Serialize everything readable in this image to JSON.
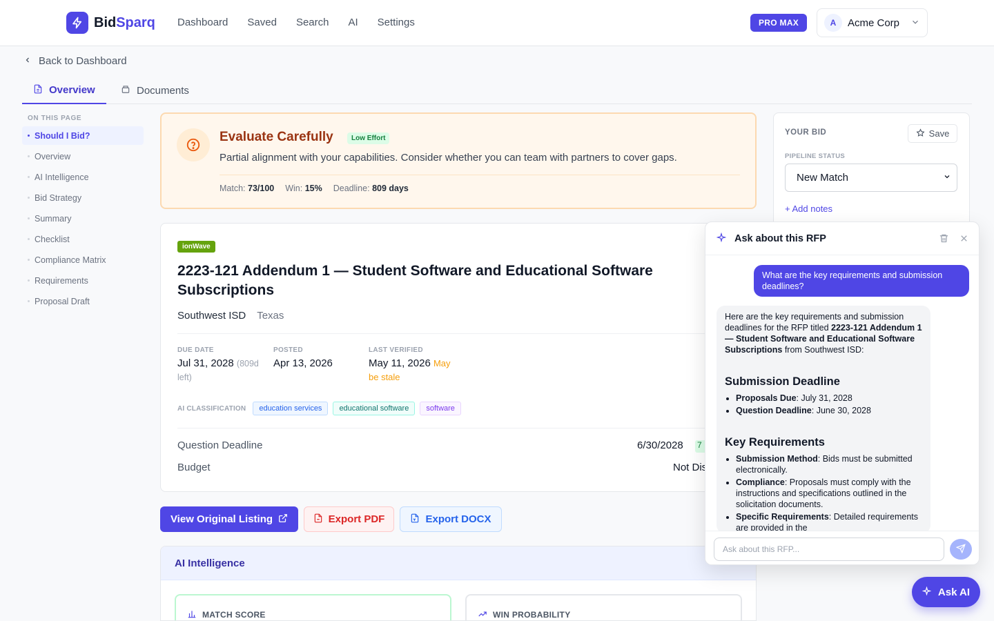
{
  "brand": {
    "name_part1": "Bid",
    "name_part2": "Sparq",
    "accent": "#4f46e5"
  },
  "nav": [
    "Dashboard",
    "Saved",
    "Search",
    "AI",
    "Settings"
  ],
  "plan_badge": "PRO MAX",
  "org": {
    "initial": "A",
    "name": "Acme Corp"
  },
  "back_link": "Back to Dashboard",
  "tabs": [
    {
      "label": "Overview",
      "icon": "document-icon",
      "active": true
    },
    {
      "label": "Documents",
      "icon": "folder-icon",
      "active": false
    }
  ],
  "toc": {
    "heading": "ON THIS PAGE",
    "items": [
      "Should I Bid?",
      "Overview",
      "AI Intelligence",
      "Bid Strategy",
      "Summary",
      "Checklist",
      "Compliance Matrix",
      "Requirements",
      "Proposal Draft"
    ]
  },
  "evaluation": {
    "title": "Evaluate Carefully",
    "effort": "Low Effort",
    "description": "Partial alignment with your capabilities. Consider whether you can team with partners to cover gaps.",
    "stats": [
      {
        "label": "Match:",
        "value": "73/100"
      },
      {
        "label": "Win:",
        "value": "15%"
      },
      {
        "label": "Deadline:",
        "value": "809 days"
      }
    ]
  },
  "rfp": {
    "source": "ionWave",
    "title": "2223-121 Addendum 1 — Student Software and Educational Software Subscriptions",
    "agency": "Southwest ISD",
    "state": "Texas",
    "due": {
      "label": "DUE DATE",
      "value": "Jul 31, 2028",
      "note_1": "(809d",
      "note_2": "left)"
    },
    "posted": {
      "label": "POSTED",
      "value": "Apr 13, 2026"
    },
    "verified": {
      "label": "LAST VERIFIED",
      "value": "May 11, 2026",
      "warn_1": "May",
      "warn_2": "be stale"
    },
    "classification_label": "AI CLASSIFICATION",
    "classifications": [
      "education services",
      "educational software",
      "software"
    ],
    "question_deadline": {
      "label": "Question Deadline",
      "value": "6/30/2028",
      "pill": "7"
    },
    "budget": {
      "label": "Budget",
      "value": "Not Dis"
    }
  },
  "actions": {
    "view": "View Original Listing",
    "pdf": "Export PDF",
    "docx": "Export DOCX"
  },
  "ai_section": {
    "title": "AI Intelligence",
    "match_score": "MATCH SCORE",
    "win_probability": "WIN PROBABILITY"
  },
  "bid_panel": {
    "title": "YOUR BID",
    "save": "Save",
    "pipeline_label": "PIPELINE STATUS",
    "pipeline_value": "New Match",
    "add_notes": "+ Add notes"
  },
  "chat": {
    "title": "Ask about this RFP",
    "user_message": "What are the key requirements and submission deadlines?",
    "intro_1": "Here are the key requirements and submission deadlines for the RFP titled ",
    "intro_bold": "2223-121 Addendum 1 — Student Software and Educational Software Subscriptions",
    "intro_2": " from Southwest ISD:",
    "h_deadline": "Submission Deadline",
    "deadlines": [
      {
        "k": "Proposals Due",
        "v": ": July 31, 2028"
      },
      {
        "k": "Question Deadline",
        "v": ": June 30, 2028"
      }
    ],
    "h_requirements": "Key Requirements",
    "requirements": [
      {
        "k": "Submission Method",
        "v": ": Bids must be submitted electronically."
      },
      {
        "k": "Compliance",
        "v": ": Proposals must comply with the instructions and specifications outlined in the solicitation documents."
      },
      {
        "k": "Specific Requirements",
        "v": ": Detailed requirements are provided in the"
      }
    ],
    "input_placeholder": "Ask about this RFP..."
  },
  "ask_ai": "Ask AI"
}
